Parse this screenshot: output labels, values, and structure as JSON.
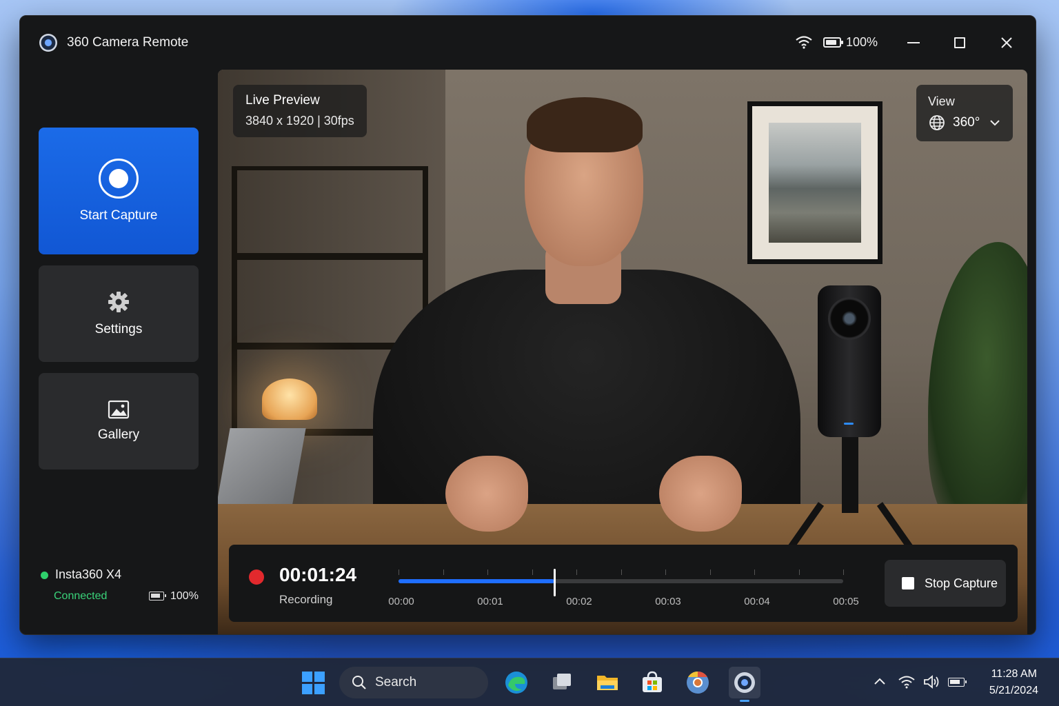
{
  "window": {
    "title": "360 Camera Remote",
    "battery_percent": "100%"
  },
  "sidebar": {
    "items": [
      {
        "label": "Start Capture",
        "icon": "record-icon",
        "active": true
      },
      {
        "label": "Settings",
        "icon": "gear-icon"
      },
      {
        "label": "Gallery",
        "icon": "image-icon"
      }
    ]
  },
  "device": {
    "name": "Insta360 X4",
    "status": "Connected",
    "battery": "100%"
  },
  "preview": {
    "title": "Live Preview",
    "resolution": "3840 x 1920 | 30fps",
    "view_label": "View",
    "view_value": "360°"
  },
  "recording": {
    "time": "00:01:24",
    "status": "Recording",
    "progress": 0.35,
    "ticks": [
      "00:00",
      "00:01",
      "00:02",
      "00:03",
      "00:04",
      "00:05"
    ],
    "stop_label": "Stop Capture"
  },
  "taskbar": {
    "search_label": "Search",
    "time": "11:28 AM",
    "date": "5/21/2024"
  },
  "colors": {
    "accent": "#1b6be8",
    "record": "#e2292d",
    "connected": "#3ad37a"
  }
}
